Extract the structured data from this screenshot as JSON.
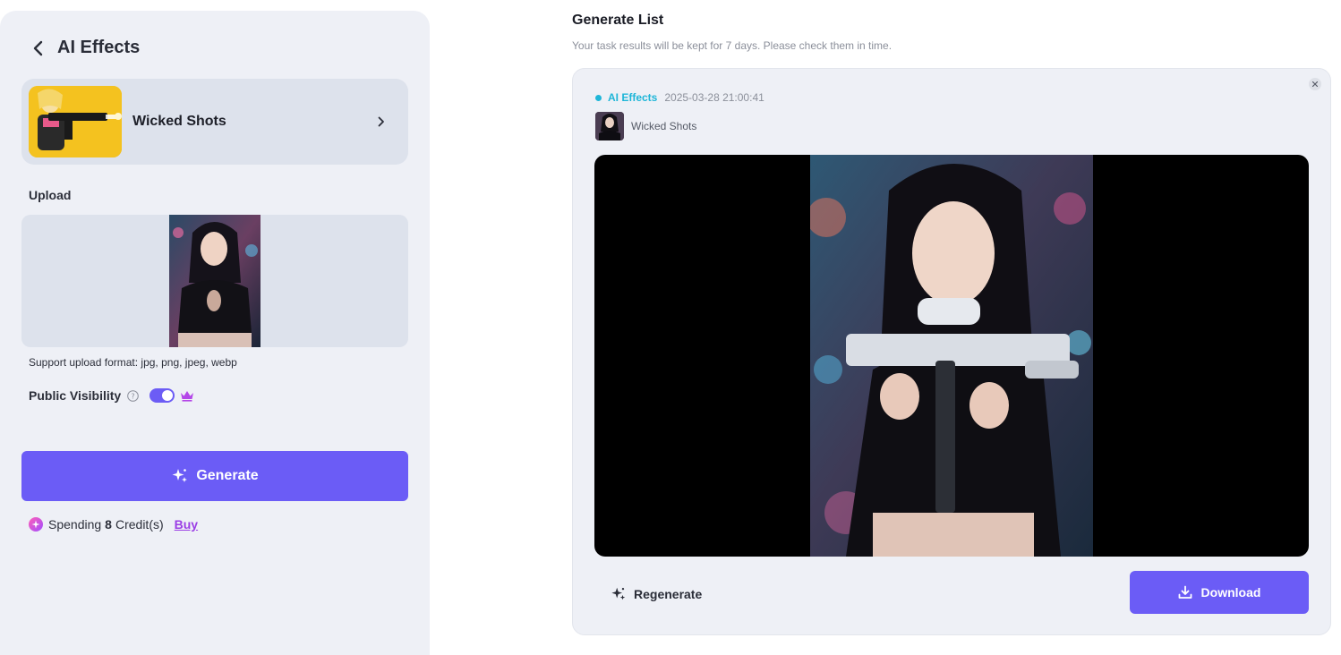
{
  "left": {
    "title": "AI Effects",
    "effect": {
      "name": "Wicked Shots"
    },
    "upload_label": "Upload",
    "support_text": "Support upload format: jpg, png, jpeg, webp",
    "visibility_label": "Public Visibility",
    "visibility_on": true,
    "generate_label": "Generate",
    "spending_prefix": "Spending",
    "spending_count": "8",
    "spending_suffix": "Credit(s)",
    "buy_label": "Buy"
  },
  "right": {
    "title": "Generate List",
    "subtitle": "Your task results will be kept for 7 days. Please check them in time.",
    "task": {
      "type": "AI Effects",
      "time": "2025-03-28 21:00:41",
      "effect_name": "Wicked Shots",
      "regenerate_label": "Regenerate",
      "download_label": "Download"
    }
  },
  "colors": {
    "accent": "#6b5cf6",
    "task_type": "#1fb6d8",
    "buy": "#9b3ee5"
  }
}
